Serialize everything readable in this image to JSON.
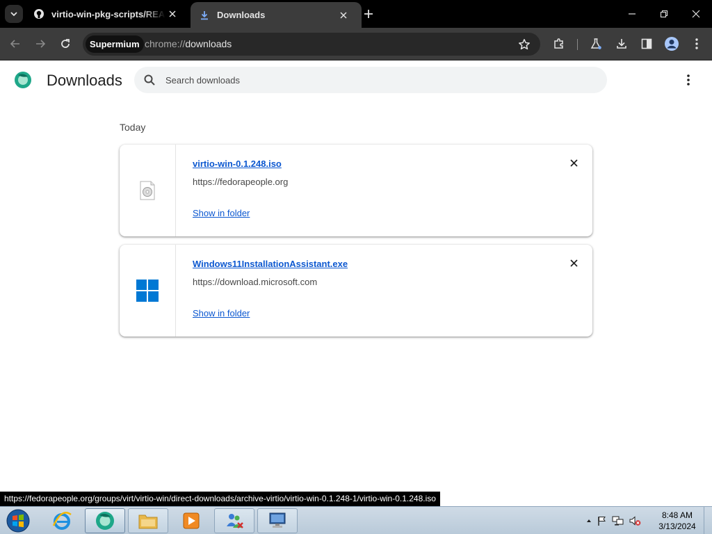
{
  "tabs": [
    {
      "title": "virtio-win-pkg-scripts/README.m",
      "icon": "github-icon",
      "active": false
    },
    {
      "title": "Downloads",
      "icon": "download-icon",
      "active": true
    }
  ],
  "toolbar": {
    "site_chip": "Supermium",
    "url_scheme": "chrome://",
    "url_path": "downloads"
  },
  "page": {
    "title": "Downloads",
    "search_placeholder": "Search downloads",
    "section": "Today"
  },
  "downloads": [
    {
      "file_name": "virtio-win-0.1.248.iso",
      "source": "https://fedorapeople.org",
      "action": "Show in folder",
      "icon": "disc-image-icon"
    },
    {
      "file_name": "Windows11InstallationAssistant.exe",
      "source": "https://download.microsoft.com",
      "action": "Show in folder",
      "icon": "windows-logo-icon"
    }
  ],
  "status_url": "https://fedorapeople.org/groups/virt/virtio-win/direct-downloads/archive-virtio/virtio-win-0.1.248-1/virtio-win-0.1.248.iso",
  "taskbar": {
    "time": "8:48 AM",
    "date": "3/13/2024"
  },
  "colors": {
    "link": "#0b57d0",
    "titlebar": "#000000",
    "toolbar": "#3c3c3c"
  }
}
